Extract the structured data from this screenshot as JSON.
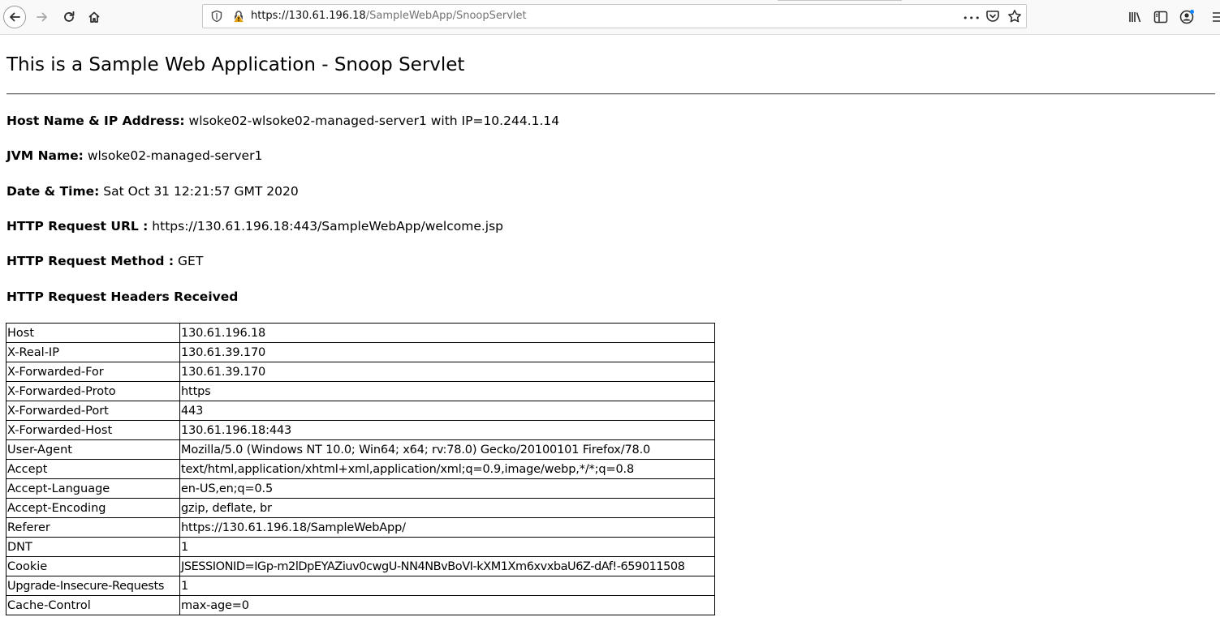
{
  "browser": {
    "url_host": "https://130.61.196.18",
    "url_path": "/SampleWebApp/SnoopServlet",
    "more_label": "•••"
  },
  "page": {
    "title": "This is a Sample Web Application - Snoop Servlet",
    "host_label": "Host Name & IP Address:",
    "host_value": "wlsoke02-wlsoke02-managed-server1 with IP=10.244.1.14",
    "jvm_label": "JVM Name:",
    "jvm_value": "wlsoke02-managed-server1",
    "date_label": "Date & Time:",
    "date_value": "Sat Oct 31 12:21:57 GMT 2020",
    "url_label": "HTTP Request URL :",
    "url_value": "https://130.61.196.18:443/SampleWebApp/welcome.jsp",
    "method_label": "HTTP Request Method :",
    "method_value": "GET",
    "headers_title": "HTTP Request Headers Received",
    "headers": [
      {
        "name": "Host",
        "value": "130.61.196.18"
      },
      {
        "name": "X-Real-IP",
        "value": "130.61.39.170"
      },
      {
        "name": "X-Forwarded-For",
        "value": "130.61.39.170"
      },
      {
        "name": "X-Forwarded-Proto",
        "value": "https"
      },
      {
        "name": "X-Forwarded-Port",
        "value": "443"
      },
      {
        "name": "X-Forwarded-Host",
        "value": "130.61.196.18:443"
      },
      {
        "name": "User-Agent",
        "value": "Mozilla/5.0 (Windows NT 10.0; Win64; x64; rv:78.0) Gecko/20100101 Firefox/78.0"
      },
      {
        "name": "Accept",
        "value": "text/html,application/xhtml+xml,application/xml;q=0.9,image/webp,*/*;q=0.8"
      },
      {
        "name": "Accept-Language",
        "value": "en-US,en;q=0.5"
      },
      {
        "name": "Accept-Encoding",
        "value": "gzip, deflate, br"
      },
      {
        "name": "Referer",
        "value": "https://130.61.196.18/SampleWebApp/"
      },
      {
        "name": "DNT",
        "value": "1"
      },
      {
        "name": "Cookie",
        "value": "JSESSIONID=IGp-m2lDpEYAZiuv0cwgU-NN4NBvBoVI-kXM1Xm6xvxbaU6Z-dAf!-659011508"
      },
      {
        "name": "Upgrade-Insecure-Requests",
        "value": "1"
      },
      {
        "name": "Cache-Control",
        "value": "max-age=0"
      }
    ]
  },
  "icons": {
    "back": "back-arrow-icon",
    "forward": "forward-arrow-icon",
    "reload": "reload-icon",
    "home": "home-icon",
    "shield": "tracking-shield-icon",
    "lock": "insecure-lock-icon",
    "pocket": "pocket-icon",
    "star": "bookmark-star-icon",
    "library": "library-icon",
    "sidebar": "sidebar-icon",
    "account": "account-icon",
    "menu": "hamburger-menu-icon"
  },
  "colors": {
    "lock_warning": "#e5a00d",
    "account_dot": "#0a84ff"
  }
}
